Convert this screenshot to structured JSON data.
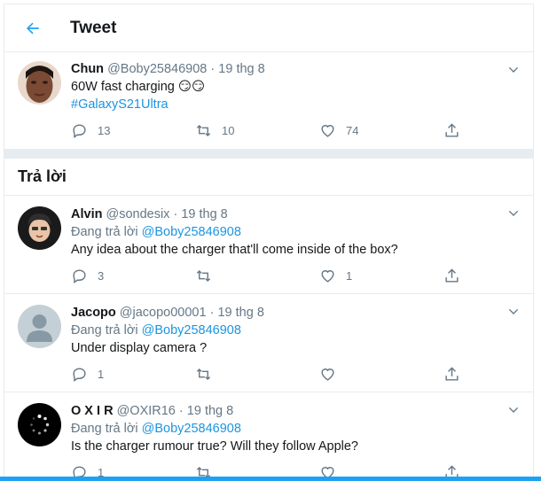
{
  "header": {
    "title": "Tweet"
  },
  "main_tweet": {
    "name": "Chun",
    "handle": "@Boby25846908",
    "date": "19 thg 8",
    "text": "60W fast charging 😏😏",
    "hashtag": "#GalaxyS21Ultra",
    "replies": "13",
    "retweets": "10",
    "likes": "74"
  },
  "replies_section": {
    "title": "Trả lời"
  },
  "replies": [
    {
      "name": "Alvin",
      "handle": "@sondesix",
      "date": "19 thg 8",
      "replying_label": "Đang trả lời",
      "replying_to": "@Boby25846908",
      "text": "Any idea about the charger that'll come inside of the box?",
      "replies": "3",
      "retweets": "",
      "likes": "1"
    },
    {
      "name": "Jacopo",
      "handle": "@jacopo00001",
      "date": "19 thg 8",
      "replying_label": "Đang trả lời",
      "replying_to": "@Boby25846908",
      "text": "Under display camera ?",
      "replies": "1",
      "retweets": "",
      "likes": ""
    },
    {
      "name": "O X I R",
      "handle": "@OXIR16",
      "date": "19 thg 8",
      "replying_label": "Đang trả lời",
      "replying_to": "@Boby25846908",
      "text": "Is the charger rumour true? Will they follow Apple?",
      "replies": "1",
      "retweets": "",
      "likes": ""
    }
  ],
  "dot": "·",
  "colors": {
    "accent": "#1da1f2",
    "link": "#1b95e0",
    "muted": "#657786",
    "border": "#e6ecf0"
  },
  "icons": [
    "back-arrow-icon",
    "chevron-down-icon",
    "reply-icon",
    "retweet-icon",
    "like-icon",
    "share-icon"
  ]
}
